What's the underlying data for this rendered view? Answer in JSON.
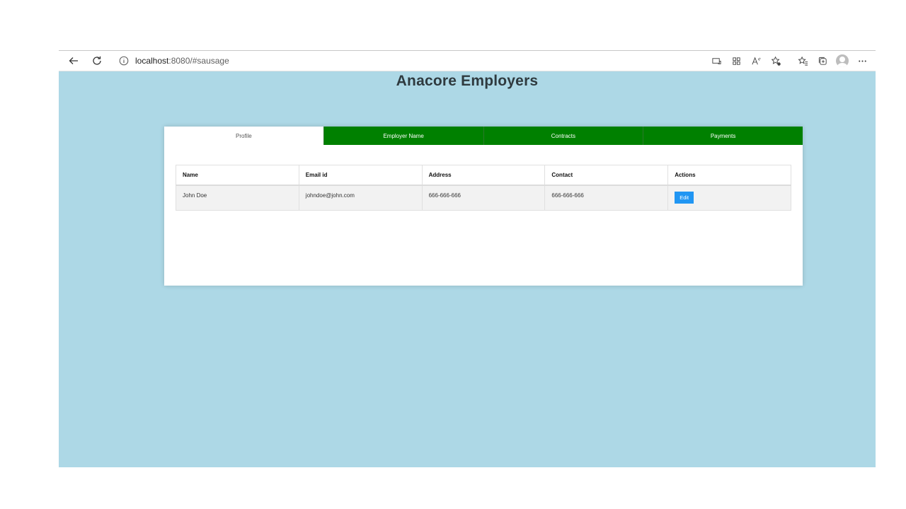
{
  "browser": {
    "url_host": "localhost",
    "url_rest": ":8080/#sausage"
  },
  "page": {
    "title": "Anacore Employers"
  },
  "tabs": [
    {
      "label": "Profile",
      "active": true
    },
    {
      "label": "Employer Name",
      "active": false
    },
    {
      "label": "Contracts",
      "active": false
    },
    {
      "label": "Payments",
      "active": false
    }
  ],
  "table": {
    "headers": [
      "Name",
      "Email id",
      "Address",
      "Contact",
      "Actions"
    ],
    "rows": [
      {
        "name": "John Doe",
        "email": "johndoe@john.com",
        "address": "666-666-666",
        "contact": "666-666-666",
        "action_label": "Edit"
      }
    ]
  },
  "colors": {
    "background": "#add8e6",
    "tab_active": "#ffffff",
    "tab_inactive": "#008000",
    "edit_button": "#2196f3"
  },
  "icons": [
    "back-arrow-icon",
    "refresh-icon",
    "info-icon",
    "immersive-reader-icon",
    "apps-icon",
    "read-aloud-icon",
    "add-favorite-icon",
    "favorites-icon",
    "collections-icon",
    "profile-avatar-icon",
    "more-menu-icon"
  ]
}
